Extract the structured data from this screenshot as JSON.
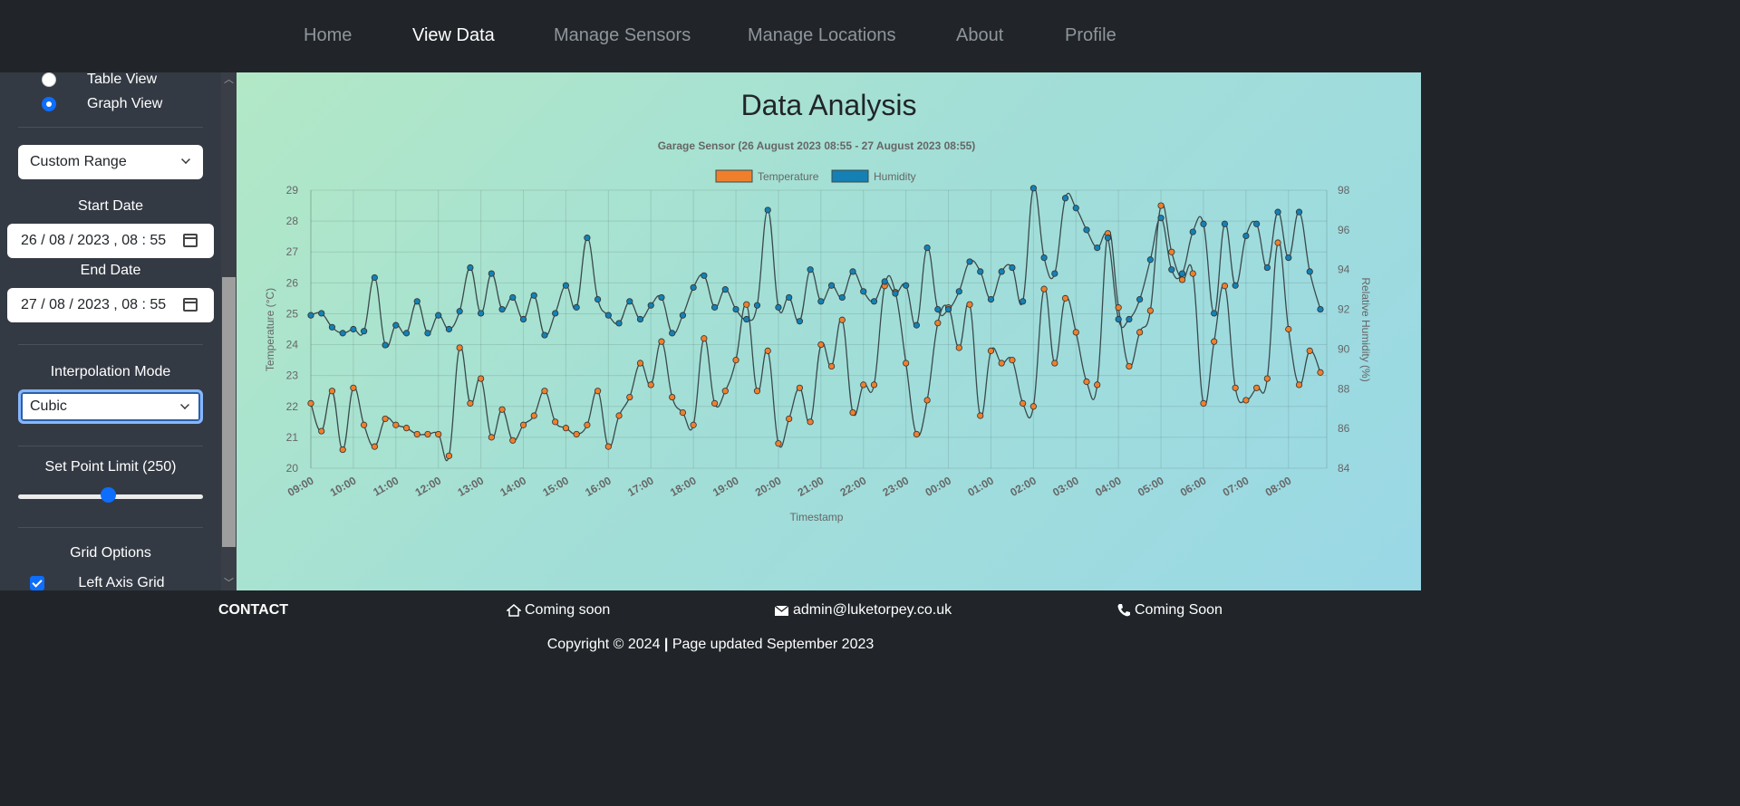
{
  "nav": {
    "items": [
      {
        "label": "Home",
        "active": false
      },
      {
        "label": "View Data",
        "active": true
      },
      {
        "label": "Manage Sensors",
        "active": false
      },
      {
        "label": "Manage Locations",
        "active": false
      },
      {
        "label": "About",
        "active": false
      },
      {
        "label": "Profile",
        "active": false
      }
    ]
  },
  "sidebar": {
    "view_options": [
      {
        "label": "Table View",
        "checked": false
      },
      {
        "label": "Graph View",
        "checked": true
      }
    ],
    "range_select": "Custom Range",
    "start_date_label": "Start Date",
    "start_date_value": "26 / 08 / 2023 ,  08 : 55",
    "end_date_label": "End Date",
    "end_date_value": "27 / 08 / 2023 ,  08 : 55",
    "interpolation_label": "Interpolation Mode",
    "interpolation_value": "Cubic",
    "point_limit_label": "Set Point Limit (250)",
    "point_limit_fraction": 0.47,
    "grid_options_label": "Grid Options",
    "left_axis_grid_label": "Left Axis Grid",
    "left_axis_grid_checked": true
  },
  "main": {
    "title": "Data Analysis"
  },
  "chart_data": {
    "type": "line",
    "title": "Garage Sensor (26 August 2023 08:55  -  27 August 2023 08:55)",
    "xlabel": "Timestamp",
    "ylabel_left": "Temperature (°C)",
    "ylabel_right": "Relative Humidity (%)",
    "ylim_left": [
      20,
      29
    ],
    "ylim_right": [
      84,
      98
    ],
    "yticks_left": [
      "20",
      "21",
      "22",
      "23",
      "24",
      "25",
      "26",
      "27",
      "28",
      "29"
    ],
    "yticks_right": [
      "84",
      "86",
      "88",
      "90",
      "92",
      "94",
      "96",
      "98"
    ],
    "xticks": [
      "09:00",
      "10:00",
      "11:00",
      "12:00",
      "13:00",
      "14:00",
      "15:00",
      "16:00",
      "17:00",
      "18:00",
      "19:00",
      "20:00",
      "21:00",
      "22:00",
      "23:00",
      "00:00",
      "01:00",
      "02:00",
      "03:00",
      "04:00",
      "05:00",
      "06:00",
      "07:00",
      "08:00"
    ],
    "x_hours_range": [
      0,
      23.9
    ],
    "grid": true,
    "legend_position": "top-center",
    "colors": {
      "temperature": "#f07f2c",
      "humidity": "#1580b4",
      "line": "#3a4a4c"
    },
    "series": [
      {
        "name": "Temperature",
        "axis": "left",
        "x": [
          0.0,
          0.25,
          0.5,
          0.75,
          1.0,
          1.25,
          1.5,
          1.75,
          2.0,
          2.25,
          2.5,
          2.75,
          3.0,
          3.25,
          3.5,
          3.75,
          4.0,
          4.25,
          4.5,
          4.75,
          5.0,
          5.25,
          5.5,
          5.75,
          6.0,
          6.25,
          6.5,
          6.75,
          7.0,
          7.25,
          7.5,
          7.75,
          8.0,
          8.25,
          8.5,
          8.75,
          9.0,
          9.25,
          9.5,
          9.75,
          10.0,
          10.25,
          10.5,
          10.75,
          11.0,
          11.25,
          11.5,
          11.75,
          12.0,
          12.25,
          12.5,
          12.75,
          13.0,
          13.25,
          13.5,
          13.75,
          14.0,
          14.25,
          14.5,
          14.75,
          15.0,
          15.25,
          15.5,
          15.75,
          16.0,
          16.25,
          16.5,
          16.75,
          17.0,
          17.25,
          17.5,
          17.75,
          18.0,
          18.25,
          18.5,
          18.75,
          19.0,
          19.25,
          19.5,
          19.75,
          20.0,
          20.25,
          20.5,
          20.75,
          21.0,
          21.25,
          21.5,
          21.75,
          22.0,
          22.25,
          22.5,
          22.75,
          23.0,
          23.25,
          23.5,
          23.75
        ],
        "values": [
          22.1,
          21.2,
          22.5,
          20.6,
          22.6,
          21.4,
          20.7,
          21.6,
          21.4,
          21.3,
          21.1,
          21.1,
          21.1,
          20.4,
          23.9,
          22.1,
          22.9,
          21.0,
          21.9,
          20.9,
          21.4,
          21.7,
          22.5,
          21.5,
          21.3,
          21.1,
          21.4,
          22.5,
          20.7,
          21.7,
          22.3,
          23.4,
          22.7,
          24.1,
          22.3,
          21.8,
          21.4,
          24.2,
          22.1,
          22.5,
          23.5,
          25.3,
          22.5,
          23.8,
          20.8,
          21.6,
          22.6,
          21.5,
          24.0,
          23.3,
          24.8,
          21.8,
          22.7,
          22.7,
          25.9,
          25.7,
          23.4,
          21.1,
          22.2,
          24.7,
          25.2,
          23.9,
          25.3,
          21.7,
          23.8,
          23.4,
          23.5,
          22.1,
          22.0,
          25.8,
          23.4,
          25.5,
          24.4,
          22.8,
          22.7,
          27.6,
          25.2,
          23.3,
          24.4,
          25.1,
          28.5,
          27.0,
          26.1,
          26.3,
          22.1,
          24.1,
          25.9,
          22.6,
          22.2,
          22.6,
          22.9,
          27.3,
          24.5,
          22.7,
          23.8,
          23.1
        ]
      },
      {
        "name": "Humidity",
        "axis": "right",
        "x": [
          0.0,
          0.25,
          0.5,
          0.75,
          1.0,
          1.25,
          1.5,
          1.75,
          2.0,
          2.25,
          2.5,
          2.75,
          3.0,
          3.25,
          3.5,
          3.75,
          4.0,
          4.25,
          4.5,
          4.75,
          5.0,
          5.25,
          5.5,
          5.75,
          6.0,
          6.25,
          6.5,
          6.75,
          7.0,
          7.25,
          7.5,
          7.75,
          8.0,
          8.25,
          8.5,
          8.75,
          9.0,
          9.25,
          9.5,
          9.75,
          10.0,
          10.25,
          10.5,
          10.75,
          11.0,
          11.25,
          11.5,
          11.75,
          12.0,
          12.25,
          12.5,
          12.75,
          13.0,
          13.25,
          13.5,
          13.75,
          14.0,
          14.25,
          14.5,
          14.75,
          15.0,
          15.25,
          15.5,
          15.75,
          16.0,
          16.25,
          16.5,
          16.75,
          17.0,
          17.25,
          17.5,
          17.75,
          18.0,
          18.25,
          18.5,
          18.75,
          19.0,
          19.25,
          19.5,
          19.75,
          20.0,
          20.25,
          20.5,
          20.75,
          21.0,
          21.25,
          21.5,
          21.75,
          22.0,
          22.25,
          22.5,
          22.75,
          23.0,
          23.25,
          23.5,
          23.75
        ],
        "values": [
          91.7,
          91.8,
          91.1,
          90.8,
          91.0,
          90.9,
          93.6,
          90.2,
          91.2,
          90.8,
          92.4,
          90.8,
          91.7,
          91.0,
          91.9,
          94.1,
          91.8,
          93.8,
          92.0,
          92.6,
          91.5,
          92.7,
          90.7,
          91.8,
          93.2,
          92.1,
          95.6,
          92.5,
          91.7,
          91.3,
          92.4,
          91.5,
          92.2,
          92.6,
          90.8,
          91.7,
          93.1,
          93.7,
          92.1,
          93.0,
          92.0,
          91.5,
          92.2,
          97.0,
          92.1,
          92.6,
          91.4,
          94.0,
          92.4,
          93.2,
          92.6,
          93.9,
          92.9,
          92.4,
          93.4,
          92.8,
          93.2,
          91.2,
          95.1,
          92.0,
          92.0,
          92.9,
          94.4,
          93.9,
          92.5,
          93.9,
          94.1,
          92.4,
          98.1,
          94.6,
          93.8,
          97.6,
          97.1,
          96.0,
          95.1,
          95.6,
          91.5,
          91.5,
          92.5,
          94.5,
          96.6,
          94.0,
          93.8,
          95.9,
          96.3,
          91.8,
          96.3,
          93.2,
          95.7,
          96.3,
          94.1,
          96.9,
          94.6,
          96.9,
          93.9,
          92.0
        ]
      }
    ]
  },
  "footer": {
    "contact_label": "CONTACT",
    "address": "Coming soon",
    "email": "admin@luketorpey.co.uk",
    "phone": "Coming Soon",
    "copyright_prefix": "Copyright © 2024",
    "separator": "|",
    "copyright_suffix": "Page updated September 2023"
  }
}
